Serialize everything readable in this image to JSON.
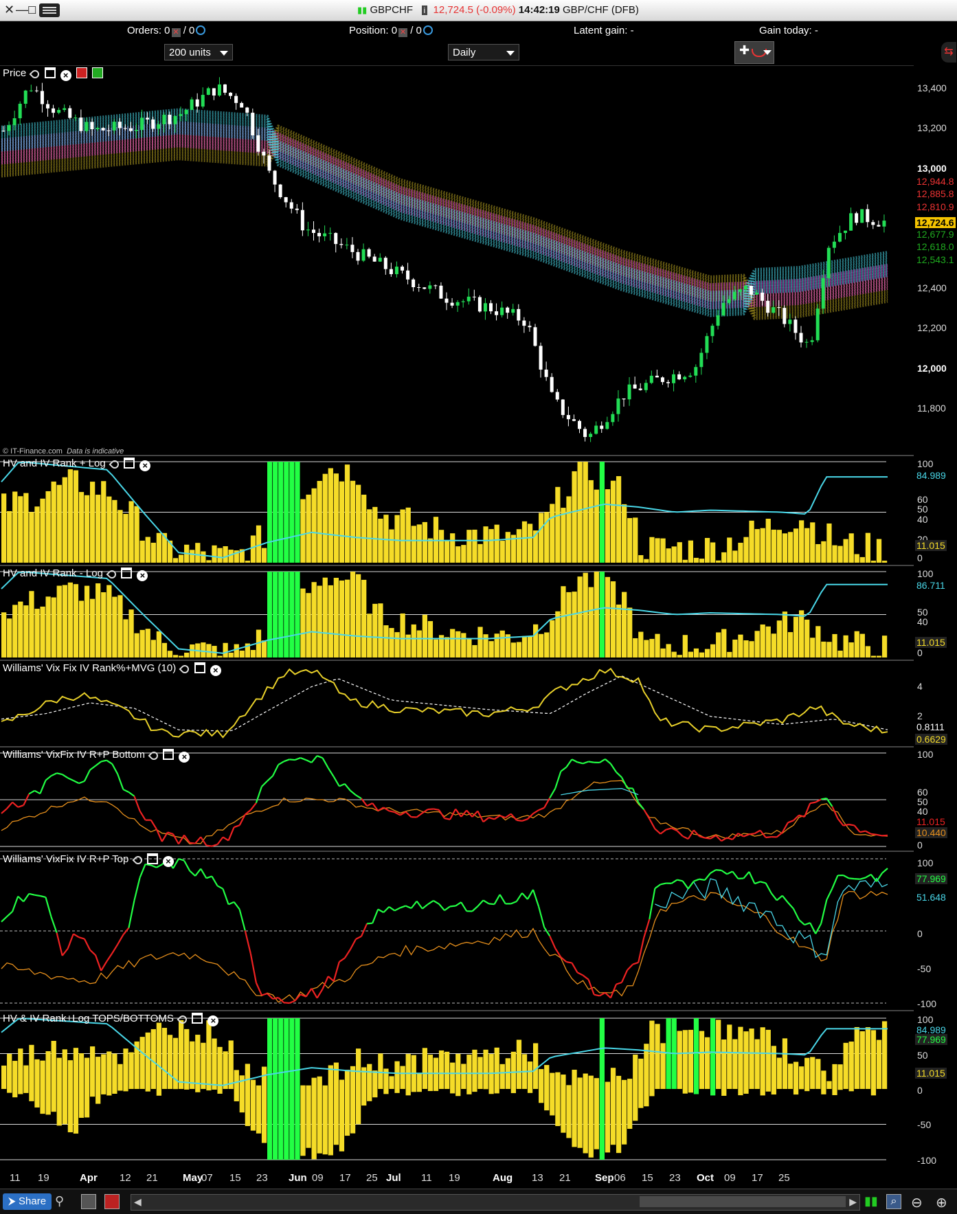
{
  "window": {
    "instrument": "GBPCHF",
    "price": "12,724.5",
    "change": "(-0.09%)",
    "time": "14:42:19",
    "pair_label": "GBP/CHF (DFB)"
  },
  "orders_bar": {
    "orders_label": "Orders: 0",
    "orders_second": "/ 0",
    "position_label": "Position: 0",
    "position_second": "/ 0",
    "latent_gain": "Latent gain: -",
    "gain_today": "Gain today: -"
  },
  "controls": {
    "units": "200 units",
    "timeframe": "Daily"
  },
  "panels": {
    "price": {
      "title": "Price",
      "copyright": "© IT-Finance.com",
      "note": "Data is indicative"
    },
    "hvrank_log": {
      "title": "HV and IV Rank + Log"
    },
    "hvrank_nolog": {
      "title": "HV and IV Rank - Log"
    },
    "vixfix_rank": {
      "title": "Williams' Vix Fix IV Rank%+MVG (10)"
    },
    "vixfix_bottom": {
      "title": "Williams' VixFix IV R+P Bottom"
    },
    "vixfix_top": {
      "title": "Williams' VixFix IV R+P Top"
    },
    "tops_bottoms": {
      "title": "HV & IV Rank+Log TOPS/BOTTOMS"
    }
  },
  "price_axis": {
    "ticks": [
      "13,400",
      "13,200",
      "13,000",
      "12,400",
      "12,200",
      "12,000",
      "11,800"
    ],
    "tags": [
      {
        "text": "12,944.8",
        "color": "#e33"
      },
      {
        "text": "12,885.8",
        "color": "#e33"
      },
      {
        "text": "12,810.9",
        "color": "#e33"
      },
      {
        "text": "12,724.6",
        "color": "#f5c400"
      },
      {
        "text": "12,677.9",
        "color": "#1faa1f"
      },
      {
        "text": "12,618.0",
        "color": "#1faa1f"
      },
      {
        "text": "12,543.1",
        "color": "#1faa1f"
      }
    ]
  },
  "axis_values": {
    "hvlog": {
      "ticks": [
        "100",
        "60",
        "50",
        "40",
        "20",
        "0"
      ],
      "cyan": "84.989",
      "yellow": "11.015"
    },
    "hvnolog": {
      "ticks": [
        "100",
        "50",
        "40",
        "0"
      ],
      "cyan": "86.711",
      "yellow": "11.015"
    },
    "vixrank": {
      "ticks": [
        "4",
        "2"
      ],
      "white": "0.8111",
      "yellow": "0.6629"
    },
    "bottom": {
      "ticks": [
        "100",
        "60",
        "50",
        "40",
        "0"
      ],
      "red": "11.015",
      "orange": "10.440"
    },
    "top": {
      "ticks": [
        "100",
        "0",
        "-50",
        "-100"
      ],
      "green": "77.969",
      "cyan": "51.648"
    },
    "tb": {
      "ticks": [
        "100",
        "50",
        "0",
        "-50",
        "-100"
      ],
      "cyan": "84.989",
      "green": "77.969",
      "yellow": "11.015"
    }
  },
  "dates": [
    {
      "t": "11",
      "x": 22
    },
    {
      "t": "19",
      "x": 63
    },
    {
      "t": "Apr",
      "x": 124,
      "b": true
    },
    {
      "t": "12",
      "x": 182
    },
    {
      "t": "21",
      "x": 221
    },
    {
      "t": "May",
      "x": 274,
      "b": true
    },
    {
      "t": "07",
      "x": 301
    },
    {
      "t": "15",
      "x": 342
    },
    {
      "t": "23",
      "x": 381
    },
    {
      "t": "Jun",
      "x": 428,
      "b": true
    },
    {
      "t": "09",
      "x": 462
    },
    {
      "t": "17",
      "x": 502
    },
    {
      "t": "25",
      "x": 541
    },
    {
      "t": "Jul",
      "x": 570,
      "b": true
    },
    {
      "t": "11",
      "x": 621
    },
    {
      "t": "19",
      "x": 661
    },
    {
      "t": "Aug",
      "x": 725,
      "b": true
    },
    {
      "t": "13",
      "x": 782
    },
    {
      "t": "21",
      "x": 822
    },
    {
      "t": "Sep",
      "x": 874,
      "b": true
    },
    {
      "t": "06",
      "x": 902
    },
    {
      "t": "15",
      "x": 942
    },
    {
      "t": "23",
      "x": 982
    },
    {
      "t": "Oct",
      "x": 1022,
      "b": true
    },
    {
      "t": "09",
      "x": 1062
    },
    {
      "t": "17",
      "x": 1102
    },
    {
      "t": "25",
      "x": 1141
    }
  ],
  "status": {
    "share": "Share"
  },
  "colors": {
    "bull": "#22dd55",
    "bear": "#ffffff",
    "yellow": "#f5dc28",
    "green": "#22ff44",
    "cyan": "#49d7e8",
    "magenta": "#e040d0",
    "red": "#ee2222",
    "orange": "#e8901c"
  },
  "chart_data": {
    "type": "line",
    "x_range": [
      "Mar 11",
      "Oct 25"
    ],
    "price": {
      "ylim": [
        11650,
        13450
      ],
      "close_path": [
        [
          0,
          13150
        ],
        [
          0.03,
          13360
        ],
        [
          0.06,
          13240
        ],
        [
          0.1,
          13150
        ],
        [
          0.15,
          13170
        ],
        [
          0.2,
          13230
        ],
        [
          0.24,
          13350
        ],
        [
          0.27,
          13280
        ],
        [
          0.3,
          12950
        ],
        [
          0.34,
          12700
        ],
        [
          0.4,
          12580
        ],
        [
          0.45,
          12480
        ],
        [
          0.5,
          12380
        ],
        [
          0.55,
          12330
        ],
        [
          0.59,
          12270
        ],
        [
          0.62,
          11900
        ],
        [
          0.66,
          11730
        ],
        [
          0.7,
          11930
        ],
        [
          0.74,
          12000
        ],
        [
          0.78,
          12050
        ],
        [
          0.81,
          12350
        ],
        [
          0.84,
          12420
        ],
        [
          0.88,
          12280
        ],
        [
          0.91,
          12150
        ],
        [
          0.93,
          12620
        ],
        [
          0.96,
          12760
        ],
        [
          1.0,
          12724
        ]
      ]
    },
    "hv_rank": {
      "ylim": [
        0,
        100
      ],
      "cyan_last": 84.989,
      "yellow_last": 11.015
    },
    "vixfix_rank": {
      "ylim": [
        0,
        5.5
      ],
      "yellow_last": 0.6629,
      "ma_last": 0.8111
    },
    "vixfix_bottom": {
      "ylim": [
        0,
        100
      ],
      "last": 11.015,
      "orange_last": 10.44
    },
    "vixfix_top": {
      "ylim": [
        -100,
        100
      ],
      "green_last": 77.969,
      "cyan_last": 51.648
    }
  }
}
